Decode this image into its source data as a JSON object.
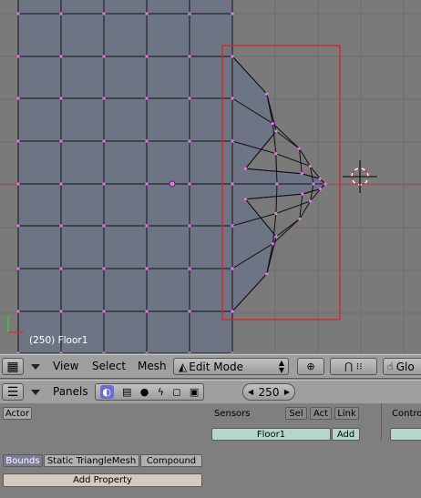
{
  "viewport": {
    "object_label": "(250) Floor1",
    "colors": {
      "background": "#7a7a7a",
      "face": "#6d7585",
      "wire": "#111111",
      "vertex": "#ff66ff",
      "bbox": "#e02020"
    }
  },
  "header3d": {
    "menus": [
      "View",
      "Select",
      "Mesh"
    ],
    "mode": "Edit Mode",
    "cut_label": "Glo"
  },
  "header_buttons": {
    "panels_label": "Panels",
    "frame": "250"
  },
  "logic": {
    "actor": "Actor",
    "sensors": "Sensors",
    "sel": "Sel",
    "act": "Act",
    "link": "Link",
    "controllers_cut": "Contro",
    "object_name": "Floor1",
    "add": "Add",
    "bounds": "Bounds",
    "bound_type": "Static TriangleMesh",
    "compound": "Compound",
    "add_property": "Add Property"
  }
}
